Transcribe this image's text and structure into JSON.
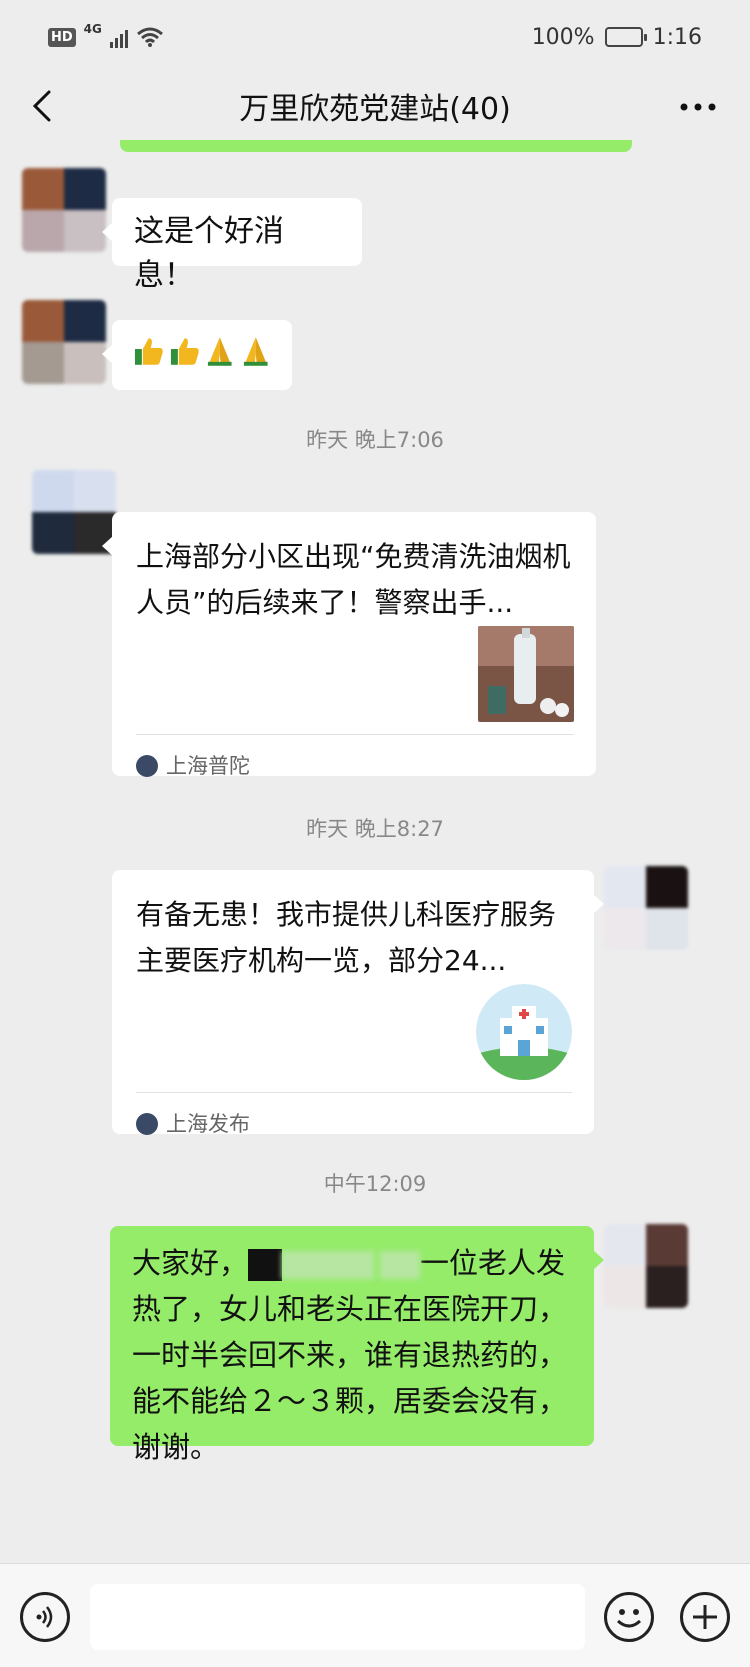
{
  "status_bar": {
    "hd": "HD",
    "network": "4G",
    "battery": "100%",
    "clock": "1:16"
  },
  "header": {
    "title": "万里欣苑党建站(40)"
  },
  "messages": [
    {
      "text": "这是个好消息！"
    },
    {
      "emojis": [
        "thumbs-up",
        "thumbs-up",
        "folded-hands",
        "folded-hands"
      ]
    }
  ],
  "timestamps": {
    "t1": "昨天 晚上7:06",
    "t2": "昨天 晚上8:27",
    "t3": "中午12:09"
  },
  "cards": [
    {
      "title": "上海部分小区出现“免费清洗油烟机人员”的后续来了！警察出手...",
      "source": "上海普陀"
    },
    {
      "title": "有备无患！我市提供儿科医疗服务主要医疗机构一览，部分24...",
      "source": "上海发布"
    }
  ],
  "last_message": {
    "prefix": "大家好，",
    "rest": "一位老人发热了，女儿和老头正在医院开刀，一时半会回不来，谁有退热药的，能不能给２～３颗，居委会没有，谢谢。"
  },
  "colors": {
    "green_bubble": "#95ec69",
    "background": "#ededed"
  },
  "icons": {
    "back": "chevron-left-icon",
    "more": "more-dots-icon",
    "voice": "voice-icon",
    "emoji": "emoji-icon",
    "plus": "plus-icon"
  }
}
